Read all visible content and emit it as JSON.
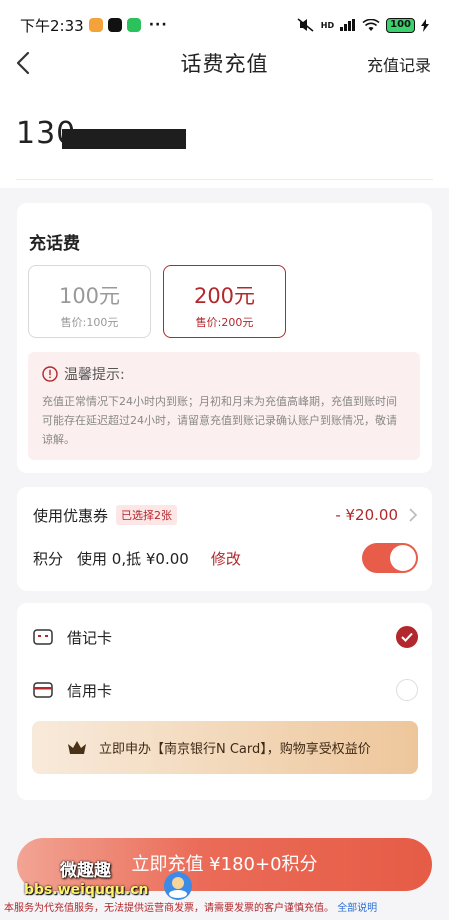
{
  "statusbar": {
    "time": "下午2:33",
    "dots": "···",
    "network": "HD",
    "battery": "100"
  },
  "nav": {
    "title": "话费充值",
    "record": "充值记录"
  },
  "phone": {
    "number_visible": "130"
  },
  "recharge": {
    "section_title": "充话费",
    "options": [
      {
        "amount": "100元",
        "price": "售价:100元",
        "selected": false
      },
      {
        "amount": "200元",
        "price": "售价:200元",
        "selected": true
      }
    ],
    "tips_title": "温馨提示:",
    "tips_body": "充值正常情况下24小时内到账；月初和月末为充值高峰期，充值到账时间可能存在延迟超过24小时，请留意充值到账记录确认账户到账情况，敬请谅解。"
  },
  "discount": {
    "coupon_label": "使用优惠券",
    "coupon_badge": "已选择2张",
    "coupon_value": "- ¥20.00",
    "points_label": "积分",
    "points_text": "使用 0,抵 ¥0.00",
    "modify": "修改",
    "points_toggle_on": true
  },
  "payment": {
    "debit_label": "借记卡",
    "credit_label": "信用卡",
    "selected": "debit",
    "promo": "立即申办【南京银行N Card】，购物享受权益价"
  },
  "submit": {
    "label": "立即充值 ¥180+0积分"
  },
  "footer": {
    "note": "本服务为代充值服务，无法提供运营商发票，请需要发票的客户谨慎充值。",
    "link": "全部说明"
  },
  "watermark": {
    "title": "微趣趣",
    "url": "bbs.weiququ.cn"
  },
  "colors": {
    "accent": "#b2282c",
    "button": "#e65c46",
    "background": "#f5f5f7"
  }
}
